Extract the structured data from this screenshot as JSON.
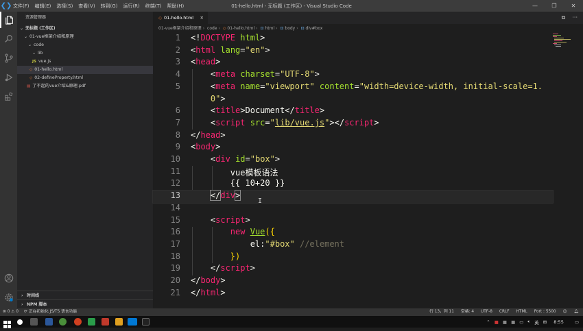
{
  "titlebar": {
    "menu": [
      "文件(F)",
      "编辑(E)",
      "选择(S)",
      "查看(V)",
      "转到(G)",
      "运行(R)",
      "终端(T)",
      "帮助(H)"
    ],
    "title": "01-hello.html - 无标题 (工作区) - Visual Studio Code",
    "controls": [
      "—",
      "❐",
      "✕"
    ]
  },
  "sidebar": {
    "title": "资源管理器",
    "workspace": "无标题 (工作区)",
    "items": [
      {
        "label": "01-vue框架介绍和原理",
        "arrow": "⌄"
      },
      {
        "label": "code",
        "arrow": "⌄"
      },
      {
        "label": "lib",
        "arrow": "⌄"
      },
      {
        "label": "vue.js",
        "badge": "JS"
      },
      {
        "label": "01-hello.html",
        "badge": "◇"
      },
      {
        "label": "02-defineProperty.html",
        "badge": "◇"
      },
      {
        "label": "了不起的vue介绍&原理.pdf",
        "badge": "▤"
      }
    ],
    "outline": "时间线",
    "npm": "NPM 脚本"
  },
  "tab": {
    "label": "01-hello.html",
    "close": "✕"
  },
  "tab_actions": [
    "⧉",
    "···"
  ],
  "breadcrumb": [
    "01-vue框架介绍和原理",
    "code",
    "01-hello.html",
    "html",
    "body",
    "div#box"
  ],
  "editor": {
    "line_numbers": [
      "1",
      "2",
      "3",
      "4",
      "5",
      "",
      "6",
      "7",
      "8",
      "9",
      "10",
      "11",
      "12",
      "13",
      "14",
      "15",
      "16",
      "17",
      "18",
      "19",
      "20",
      "21"
    ],
    "current_line": "13"
  },
  "statusbar": {
    "errors": "⊗ 0 ⚠ 0",
    "task": "正在初始化 JS/TS 语言功能",
    "position": "行 13，列 11",
    "spaces": "空格: 4",
    "encoding": "UTF-8",
    "eol": "CRLF",
    "language": "HTML",
    "port": "Port : 5500"
  },
  "taskbar": {
    "time": "8:55",
    "ime": "英"
  },
  "colors": {
    "accent": "#007acc",
    "tag": "#f92672",
    "attr": "#a6e22e",
    "string": "#e6db74",
    "comment": "#75715e"
  }
}
